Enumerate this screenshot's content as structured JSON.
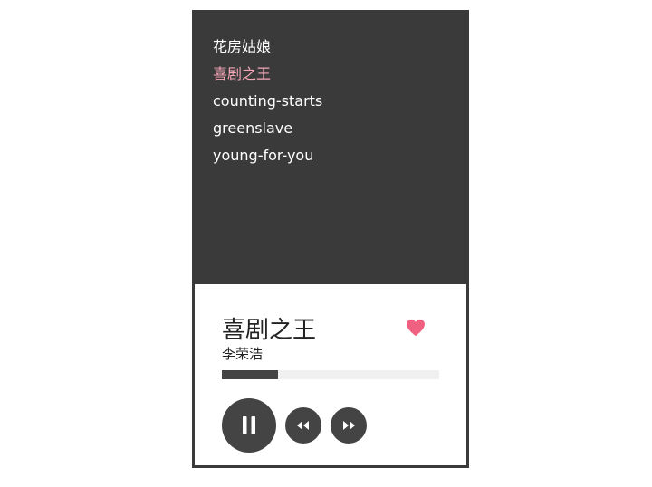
{
  "playlist": {
    "items": [
      {
        "title": "花房姑娘"
      },
      {
        "title": "喜剧之王"
      },
      {
        "title": "counting-starts"
      },
      {
        "title": "greenslave"
      },
      {
        "title": "young-for-you"
      }
    ],
    "active_index": 1,
    "active_color": "#f5a7b8"
  },
  "now_playing": {
    "title": "喜剧之王",
    "artist": "李荣浩",
    "liked": true,
    "heart_color": "#f06080",
    "progress": 0.26
  },
  "controls": {
    "play_pause_icon": "pause-icon",
    "prev_icon": "rewind-icon",
    "next_icon": "fast-forward-icon"
  },
  "colors": {
    "panel_dark": "#3a3a3a",
    "control_bg": "#444444",
    "progress_track": "#f0f0f0"
  }
}
